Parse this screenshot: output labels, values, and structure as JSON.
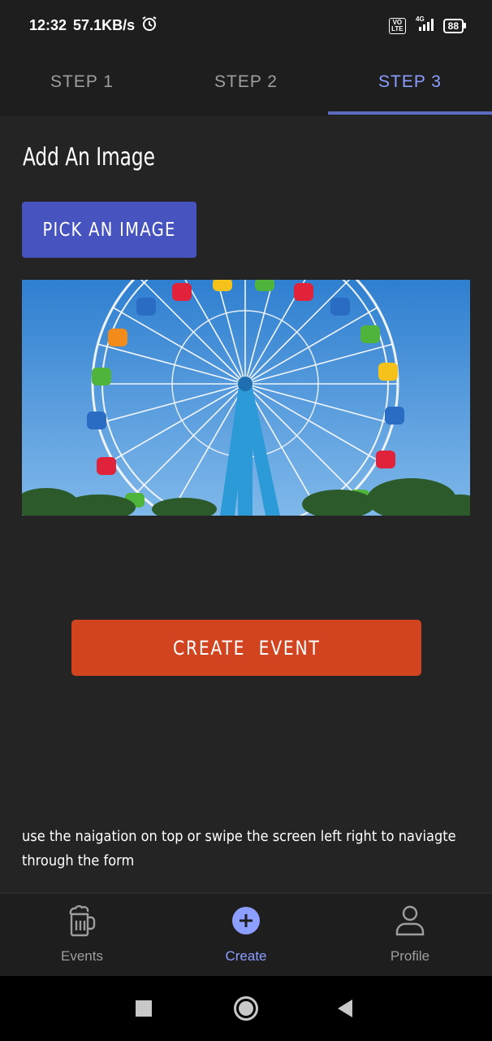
{
  "status_bar": {
    "time": "12:32",
    "speed": "57.1KB/s",
    "volte": "VO LTE",
    "network": "4G",
    "battery": "88"
  },
  "tabs": [
    {
      "label": "STEP  1",
      "active": false
    },
    {
      "label": "STEP  2",
      "active": false
    },
    {
      "label": "STEP  3",
      "active": true
    }
  ],
  "main": {
    "title": "Add An Image",
    "pick_button": "PICK AN IMAGE",
    "image_description": "ferris-wheel-photo",
    "create_button": "CREATE  EVENT",
    "help_text": "use the naigation on top or swipe the screen left right to naviagte through the form"
  },
  "bottom_nav": [
    {
      "label": "Events",
      "icon": "beer-mug-icon",
      "active": false
    },
    {
      "label": "Create",
      "icon": "plus-circle-icon",
      "active": true
    },
    {
      "label": "Profile",
      "icon": "person-icon",
      "active": false
    }
  ],
  "colors": {
    "accent": "#8c9eff",
    "pick_button": "#4754c0",
    "create_button": "#d2431f",
    "background": "#242424"
  }
}
